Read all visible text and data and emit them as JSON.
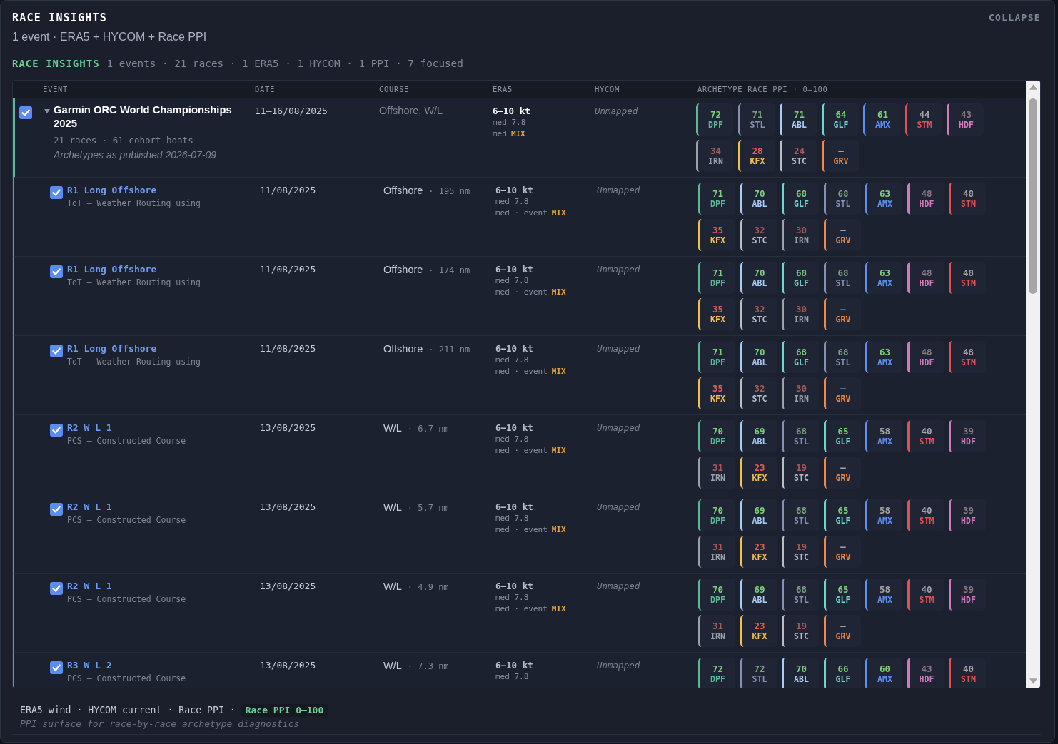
{
  "header": {
    "title": "RACE INSIGHTS",
    "subtitle": "1 event · ERA5 + HYCOM + Race PPI",
    "collapse_button": "COLLAPSE"
  },
  "summary": {
    "label": "RACE INSIGHTS",
    "text": "1 events · 21 races · 1 ERA5 · 1 HYCOM · 1 PPI · 7 focused"
  },
  "table": {
    "columns": [
      "EVENT",
      "DATE",
      "COURSE",
      "ERA5",
      "HYCOM",
      "ARCHETYPE RACE PPI · 0–100"
    ],
    "event": {
      "checked": true,
      "expanded": true,
      "name": "Garmin ORC World Championships 2025",
      "meta": "21 races · 61 cohort boats",
      "note": "Archetypes as published 2026-07-09",
      "date": "11–16/08/2025",
      "course": "Offshore, W/L",
      "era5": {
        "range": "6–10 kt",
        "median": "med 7.8",
        "mix_label": "med",
        "mix": "MIX"
      },
      "hycom": "Unmapped",
      "chips": [
        {
          "score": "72",
          "code": "DPF",
          "color": "#5cb895",
          "strong": true,
          "weak": false,
          "focused": true
        },
        {
          "score": "71",
          "code": "STL",
          "color": "#8491b4",
          "strong": true,
          "weak": false,
          "focused": false
        },
        {
          "score": "71",
          "code": "ABL",
          "color": "#a9cdf7",
          "strong": true,
          "weak": false,
          "focused": true
        },
        {
          "score": "64",
          "code": "GLF",
          "color": "#6fd6cc",
          "strong": true,
          "weak": false,
          "focused": true
        },
        {
          "score": "61",
          "code": "AMX",
          "color": "#5d8ff0",
          "strong": true,
          "weak": false,
          "focused": true
        },
        {
          "score": "44",
          "code": "STM",
          "color": "#e05252",
          "strong": false,
          "weak": false,
          "focused": true
        },
        {
          "score": "43",
          "code": "HDF",
          "color": "#d478bd",
          "strong": false,
          "weak": false,
          "focused": false
        },
        {
          "score": "34",
          "code": "IRN",
          "color": "#9ba1ab",
          "strong": false,
          "weak": true,
          "focused": false
        },
        {
          "score": "28",
          "code": "KFX",
          "color": "#f2c14e",
          "strong": false,
          "weak": true,
          "focused": true
        },
        {
          "score": "24",
          "code": "STC",
          "color": "#b8bec8",
          "strong": false,
          "weak": true,
          "focused": false
        },
        {
          "score": "–",
          "code": "GRV",
          "color": "#ee8a45",
          "strong": false,
          "weak": false,
          "focused": true
        }
      ]
    },
    "races": [
      {
        "checked": true,
        "name": "R1 Long Offshore",
        "description": "ToT – Weather Routing using",
        "date": "11/08/2025",
        "course": "Offshore",
        "distance": "· 195 nm",
        "era5": {
          "range": "6–10 kt",
          "median": "med 7.8",
          "mix_label": "med · event",
          "mix": "MIX"
        },
        "hycom": "Unmapped",
        "chips": [
          {
            "score": "71",
            "code": "DPF",
            "color": "#5cb895",
            "strong": true,
            "weak": false,
            "focused": true
          },
          {
            "score": "70",
            "code": "ABL",
            "color": "#a9cdf7",
            "strong": true,
            "weak": false,
            "focused": true
          },
          {
            "score": "68",
            "code": "GLF",
            "color": "#6fd6cc",
            "strong": true,
            "weak": false,
            "focused": true
          },
          {
            "score": "68",
            "code": "STL",
            "color": "#8491b4",
            "strong": true,
            "weak": false,
            "focused": false
          },
          {
            "score": "63",
            "code": "AMX",
            "color": "#5d8ff0",
            "strong": true,
            "weak": false,
            "focused": true
          },
          {
            "score": "48",
            "code": "HDF",
            "color": "#d478bd",
            "strong": false,
            "weak": false,
            "focused": false
          },
          {
            "score": "48",
            "code": "STM",
            "color": "#e05252",
            "strong": false,
            "weak": false,
            "focused": true
          },
          {
            "score": "35",
            "code": "KFX",
            "color": "#f2c14e",
            "strong": false,
            "weak": true,
            "focused": true
          },
          {
            "score": "32",
            "code": "STC",
            "color": "#b8bec8",
            "strong": false,
            "weak": true,
            "focused": false
          },
          {
            "score": "30",
            "code": "IRN",
            "color": "#9ba1ab",
            "strong": false,
            "weak": true,
            "focused": false
          },
          {
            "score": "–",
            "code": "GRV",
            "color": "#ee8a45",
            "strong": false,
            "weak": false,
            "focused": true
          }
        ]
      },
      {
        "checked": true,
        "name": "R1 Long Offshore",
        "description": "ToT – Weather Routing using",
        "date": "11/08/2025",
        "course": "Offshore",
        "distance": "· 174 nm",
        "era5": {
          "range": "6–10 kt",
          "median": "med 7.8",
          "mix_label": "med · event",
          "mix": "MIX"
        },
        "hycom": "Unmapped",
        "chips": [
          {
            "score": "71",
            "code": "DPF",
            "color": "#5cb895",
            "strong": true,
            "weak": false,
            "focused": true
          },
          {
            "score": "70",
            "code": "ABL",
            "color": "#a9cdf7",
            "strong": true,
            "weak": false,
            "focused": true
          },
          {
            "score": "68",
            "code": "GLF",
            "color": "#6fd6cc",
            "strong": true,
            "weak": false,
            "focused": true
          },
          {
            "score": "68",
            "code": "STL",
            "color": "#8491b4",
            "strong": true,
            "weak": false,
            "focused": false
          },
          {
            "score": "63",
            "code": "AMX",
            "color": "#5d8ff0",
            "strong": true,
            "weak": false,
            "focused": true
          },
          {
            "score": "48",
            "code": "HDF",
            "color": "#d478bd",
            "strong": false,
            "weak": false,
            "focused": false
          },
          {
            "score": "48",
            "code": "STM",
            "color": "#e05252",
            "strong": false,
            "weak": false,
            "focused": true
          },
          {
            "score": "35",
            "code": "KFX",
            "color": "#f2c14e",
            "strong": false,
            "weak": true,
            "focused": true
          },
          {
            "score": "32",
            "code": "STC",
            "color": "#b8bec8",
            "strong": false,
            "weak": true,
            "focused": false
          },
          {
            "score": "30",
            "code": "IRN",
            "color": "#9ba1ab",
            "strong": false,
            "weak": true,
            "focused": false
          },
          {
            "score": "–",
            "code": "GRV",
            "color": "#ee8a45",
            "strong": false,
            "weak": false,
            "focused": true
          }
        ]
      },
      {
        "checked": true,
        "name": "R1 Long Offshore",
        "description": "ToT – Weather Routing using",
        "date": "11/08/2025",
        "course": "Offshore",
        "distance": "· 211 nm",
        "era5": {
          "range": "6–10 kt",
          "median": "med 7.8",
          "mix_label": "med · event",
          "mix": "MIX"
        },
        "hycom": "Unmapped",
        "chips": [
          {
            "score": "71",
            "code": "DPF",
            "color": "#5cb895",
            "strong": true,
            "weak": false,
            "focused": true
          },
          {
            "score": "70",
            "code": "ABL",
            "color": "#a9cdf7",
            "strong": true,
            "weak": false,
            "focused": true
          },
          {
            "score": "68",
            "code": "GLF",
            "color": "#6fd6cc",
            "strong": true,
            "weak": false,
            "focused": true
          },
          {
            "score": "68",
            "code": "STL",
            "color": "#8491b4",
            "strong": true,
            "weak": false,
            "focused": false
          },
          {
            "score": "63",
            "code": "AMX",
            "color": "#5d8ff0",
            "strong": true,
            "weak": false,
            "focused": true
          },
          {
            "score": "48",
            "code": "HDF",
            "color": "#d478bd",
            "strong": false,
            "weak": false,
            "focused": false
          },
          {
            "score": "48",
            "code": "STM",
            "color": "#e05252",
            "strong": false,
            "weak": false,
            "focused": true
          },
          {
            "score": "35",
            "code": "KFX",
            "color": "#f2c14e",
            "strong": false,
            "weak": true,
            "focused": true
          },
          {
            "score": "32",
            "code": "STC",
            "color": "#b8bec8",
            "strong": false,
            "weak": true,
            "focused": false
          },
          {
            "score": "30",
            "code": "IRN",
            "color": "#9ba1ab",
            "strong": false,
            "weak": true,
            "focused": false
          },
          {
            "score": "–",
            "code": "GRV",
            "color": "#ee8a45",
            "strong": false,
            "weak": false,
            "focused": true
          }
        ]
      },
      {
        "checked": true,
        "name": "R2 W L 1",
        "description": "PCS – Constructed Course",
        "date": "13/08/2025",
        "course": "W/L",
        "distance": "· 6.7 nm",
        "era5": {
          "range": "6–10 kt",
          "median": "med 7.8",
          "mix_label": "med · event",
          "mix": "MIX"
        },
        "hycom": "Unmapped",
        "chips": [
          {
            "score": "70",
            "code": "DPF",
            "color": "#5cb895",
            "strong": true,
            "weak": false,
            "focused": true
          },
          {
            "score": "69",
            "code": "ABL",
            "color": "#a9cdf7",
            "strong": true,
            "weak": false,
            "focused": true
          },
          {
            "score": "68",
            "code": "STL",
            "color": "#8491b4",
            "strong": true,
            "weak": false,
            "focused": false
          },
          {
            "score": "65",
            "code": "GLF",
            "color": "#6fd6cc",
            "strong": true,
            "weak": false,
            "focused": true
          },
          {
            "score": "58",
            "code": "AMX",
            "color": "#5d8ff0",
            "strong": false,
            "weak": false,
            "focused": true
          },
          {
            "score": "40",
            "code": "STM",
            "color": "#e05252",
            "strong": false,
            "weak": false,
            "focused": true
          },
          {
            "score": "39",
            "code": "HDF",
            "color": "#d478bd",
            "strong": false,
            "weak": false,
            "focused": false
          },
          {
            "score": "31",
            "code": "IRN",
            "color": "#9ba1ab",
            "strong": false,
            "weak": true,
            "focused": false
          },
          {
            "score": "23",
            "code": "KFX",
            "color": "#f2c14e",
            "strong": false,
            "weak": true,
            "focused": true
          },
          {
            "score": "19",
            "code": "STC",
            "color": "#b8bec8",
            "strong": false,
            "weak": true,
            "focused": false
          },
          {
            "score": "–",
            "code": "GRV",
            "color": "#ee8a45",
            "strong": false,
            "weak": false,
            "focused": true
          }
        ]
      },
      {
        "checked": true,
        "name": "R2 W L 1",
        "description": "PCS – Constructed Course",
        "date": "13/08/2025",
        "course": "W/L",
        "distance": "· 5.7 nm",
        "era5": {
          "range": "6–10 kt",
          "median": "med 7.8",
          "mix_label": "med · event",
          "mix": "MIX"
        },
        "hycom": "Unmapped",
        "chips": [
          {
            "score": "70",
            "code": "DPF",
            "color": "#5cb895",
            "strong": true,
            "weak": false,
            "focused": true
          },
          {
            "score": "69",
            "code": "ABL",
            "color": "#a9cdf7",
            "strong": true,
            "weak": false,
            "focused": true
          },
          {
            "score": "68",
            "code": "STL",
            "color": "#8491b4",
            "strong": true,
            "weak": false,
            "focused": false
          },
          {
            "score": "65",
            "code": "GLF",
            "color": "#6fd6cc",
            "strong": true,
            "weak": false,
            "focused": true
          },
          {
            "score": "58",
            "code": "AMX",
            "color": "#5d8ff0",
            "strong": false,
            "weak": false,
            "focused": true
          },
          {
            "score": "40",
            "code": "STM",
            "color": "#e05252",
            "strong": false,
            "weak": false,
            "focused": true
          },
          {
            "score": "39",
            "code": "HDF",
            "color": "#d478bd",
            "strong": false,
            "weak": false,
            "focused": false
          },
          {
            "score": "31",
            "code": "IRN",
            "color": "#9ba1ab",
            "strong": false,
            "weak": true,
            "focused": false
          },
          {
            "score": "23",
            "code": "KFX",
            "color": "#f2c14e",
            "strong": false,
            "weak": true,
            "focused": true
          },
          {
            "score": "19",
            "code": "STC",
            "color": "#b8bec8",
            "strong": false,
            "weak": true,
            "focused": false
          },
          {
            "score": "–",
            "code": "GRV",
            "color": "#ee8a45",
            "strong": false,
            "weak": false,
            "focused": true
          }
        ]
      },
      {
        "checked": true,
        "name": "R2 W L 1",
        "description": "PCS – Constructed Course",
        "date": "13/08/2025",
        "course": "W/L",
        "distance": "· 4.9 nm",
        "era5": {
          "range": "6–10 kt",
          "median": "med 7.8",
          "mix_label": "med · event",
          "mix": "MIX"
        },
        "hycom": "Unmapped",
        "chips": [
          {
            "score": "70",
            "code": "DPF",
            "color": "#5cb895",
            "strong": true,
            "weak": false,
            "focused": true
          },
          {
            "score": "69",
            "code": "ABL",
            "color": "#a9cdf7",
            "strong": true,
            "weak": false,
            "focused": true
          },
          {
            "score": "68",
            "code": "STL",
            "color": "#8491b4",
            "strong": true,
            "weak": false,
            "focused": false
          },
          {
            "score": "65",
            "code": "GLF",
            "color": "#6fd6cc",
            "strong": true,
            "weak": false,
            "focused": true
          },
          {
            "score": "58",
            "code": "AMX",
            "color": "#5d8ff0",
            "strong": false,
            "weak": false,
            "focused": true
          },
          {
            "score": "40",
            "code": "STM",
            "color": "#e05252",
            "strong": false,
            "weak": false,
            "focused": true
          },
          {
            "score": "39",
            "code": "HDF",
            "color": "#d478bd",
            "strong": false,
            "weak": false,
            "focused": false
          },
          {
            "score": "31",
            "code": "IRN",
            "color": "#9ba1ab",
            "strong": false,
            "weak": true,
            "focused": false
          },
          {
            "score": "23",
            "code": "KFX",
            "color": "#f2c14e",
            "strong": false,
            "weak": true,
            "focused": true
          },
          {
            "score": "19",
            "code": "STC",
            "color": "#b8bec8",
            "strong": false,
            "weak": true,
            "focused": false
          },
          {
            "score": "–",
            "code": "GRV",
            "color": "#ee8a45",
            "strong": false,
            "weak": false,
            "focused": true
          }
        ]
      },
      {
        "checked": true,
        "name": "R3 W L 2",
        "description": "PCS – Constructed Course",
        "date": "13/08/2025",
        "course": "W/L",
        "distance": "· 7.3 nm",
        "era5": {
          "range": "6–10 kt",
          "median": "med 7.8"
        },
        "hycom": "Unmapped",
        "chips": [
          {
            "score": "72",
            "code": "DPF",
            "color": "#5cb895",
            "strong": true,
            "weak": false,
            "focused": true
          },
          {
            "score": "72",
            "code": "STL",
            "color": "#8491b4",
            "strong": true,
            "weak": false,
            "focused": false
          },
          {
            "score": "70",
            "code": "ABL",
            "color": "#a9cdf7",
            "strong": true,
            "weak": false,
            "focused": true
          },
          {
            "score": "66",
            "code": "GLF",
            "color": "#6fd6cc",
            "strong": true,
            "weak": false,
            "focused": true
          },
          {
            "score": "60",
            "code": "AMX",
            "color": "#5d8ff0",
            "strong": true,
            "weak": false,
            "focused": true
          },
          {
            "score": "43",
            "code": "HDF",
            "color": "#d478bd",
            "strong": false,
            "weak": false,
            "focused": false
          },
          {
            "score": "40",
            "code": "STM",
            "color": "#e05252",
            "strong": false,
            "weak": false,
            "focused": true
          }
        ]
      }
    ]
  },
  "footer": {
    "sources": "ERA5 wind · HYCOM current · Race PPI ·",
    "badge": "Race PPI 0–100",
    "caption": "PPI surface for race-by-race archetype diagnostics"
  }
}
